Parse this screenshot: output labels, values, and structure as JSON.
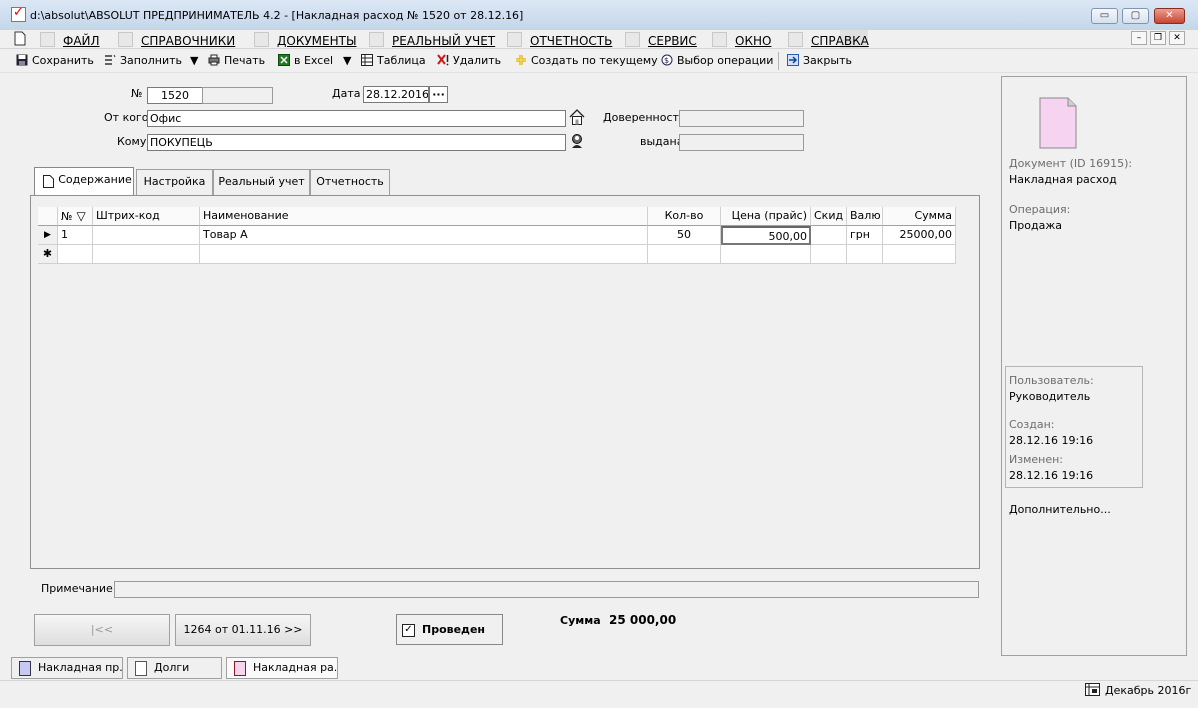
{
  "window": {
    "title": "d:\\absolut\\ABSOLUT  ПРЕДПРИНИМАТЕЛЬ 4.2 - [Накладная расход № 1520 от 28.12.16]",
    "min_glyph": "▭",
    "max_glyph": "▢",
    "close_glyph": "✕"
  },
  "menu": {
    "items": [
      "ФАЙЛ",
      "СПРАВОЧНИКИ",
      "ДОКУМЕНТЫ",
      "РЕАЛЬНЫЙ УЧЕТ",
      "ОТЧЕТНОСТЬ",
      "СЕРВИС",
      "ОКНО",
      "СПРАВКА"
    ],
    "mdi_min": "–",
    "mdi_restore": "❐",
    "mdi_close": "✕"
  },
  "toolbar": {
    "save": "Сохранить",
    "fill": "Заполнить",
    "print": "Печать",
    "excel": "в Excel",
    "table": "Таблица",
    "delete": "Удалить",
    "create_from_current": "Создать по текущему",
    "select_operation": "Выбор операции",
    "close": "Закрыть",
    "dropdown_glyph": "▼"
  },
  "header": {
    "number_label": "№",
    "number_value": "1520",
    "number_suffix": "",
    "date_label": "Дата",
    "date_value": "28.12.2016",
    "date_button": "···",
    "from_label": "От кого",
    "from_value": "Офис",
    "to_label": "Кому",
    "to_value": "ПОКУПЕЦЬ",
    "proxy_label": "Доверенность",
    "proxy_value": "",
    "issued_label": "выдана",
    "issued_value": ""
  },
  "tabs": [
    "Содержание",
    "Настройка",
    "Реальный учет",
    "Отчетность"
  ],
  "grid": {
    "columns": [
      "№",
      "Штрих-код",
      "Наименование",
      "Кол-во",
      "Цена (прайс)",
      "Скид",
      "Валю",
      "Сумма"
    ],
    "sort_glyph": "▽",
    "row_marker": "▶",
    "new_row_marker": "✱",
    "rows": [
      {
        "no": "1",
        "barcode": "",
        "name": "Товар А",
        "qty": "50",
        "price": "500,00",
        "discount": "",
        "currency": "грн",
        "sum": "25000,00"
      }
    ]
  },
  "note": {
    "label": "Примечание",
    "value": ""
  },
  "navigation": {
    "prev": "|<<",
    "next": "1264 от 01.11.16 >>"
  },
  "posted": {
    "label": "Проведен",
    "checked": true,
    "check_glyph": "✓"
  },
  "total": {
    "label": "Сумма",
    "value": "25 000,00"
  },
  "sidebar": {
    "document_label": "Документ  (ID 16915):",
    "document_value": "Накладная расход",
    "operation_label": "Операция:",
    "operation_value": "Продажа",
    "user_label": "Пользователь:",
    "user_value": "Руководитель",
    "created_label": "Создан:",
    "created_value": "28.12.16  19:16",
    "modified_label": "Изменен:",
    "modified_value": "28.12.16  19:16",
    "more_link": "Дополнительно..."
  },
  "taskbar": {
    "tabs": [
      "Накладная пр...",
      "Долги",
      "Накладная ра..."
    ]
  },
  "status": {
    "period": "Декабрь 2016г"
  },
  "colors": {
    "accent_pink": "#f7d3f2",
    "toolbar_green": "#1e7b1e",
    "toolbar_red": "#c81818",
    "title_gradient_top": "#dbe7f4"
  }
}
